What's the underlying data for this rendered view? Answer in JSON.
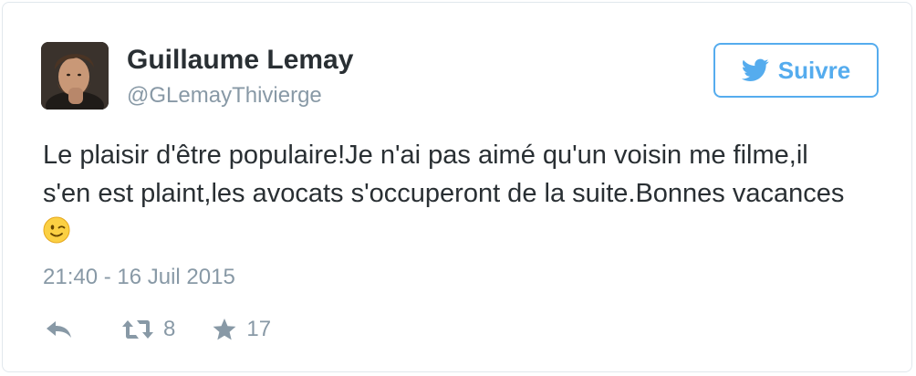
{
  "tweet": {
    "author_name": "Guillaume Lemay",
    "author_handle": "@GLemayThivierge",
    "text": "Le plaisir d'être populaire!Je n'ai pas aimé qu'un voisin me filme,il s'en est plaint,les avocats s'occuperont de la suite.Bonnes vacances",
    "emoji": "winking-face",
    "timestamp": "21:40 - 16 Juil 2015",
    "retweet_count": "8",
    "favorite_count": "17"
  },
  "follow_button": {
    "label": "Suivre",
    "icon": "twitter-bird-icon"
  },
  "actions": {
    "reply_icon": "reply-icon",
    "retweet_icon": "retweet-icon",
    "favorite_icon": "star-icon"
  },
  "colors": {
    "brand_blue": "#55acee",
    "text_primary": "#292f33",
    "text_secondary": "#8899a6",
    "border": "#e1e8ed"
  }
}
